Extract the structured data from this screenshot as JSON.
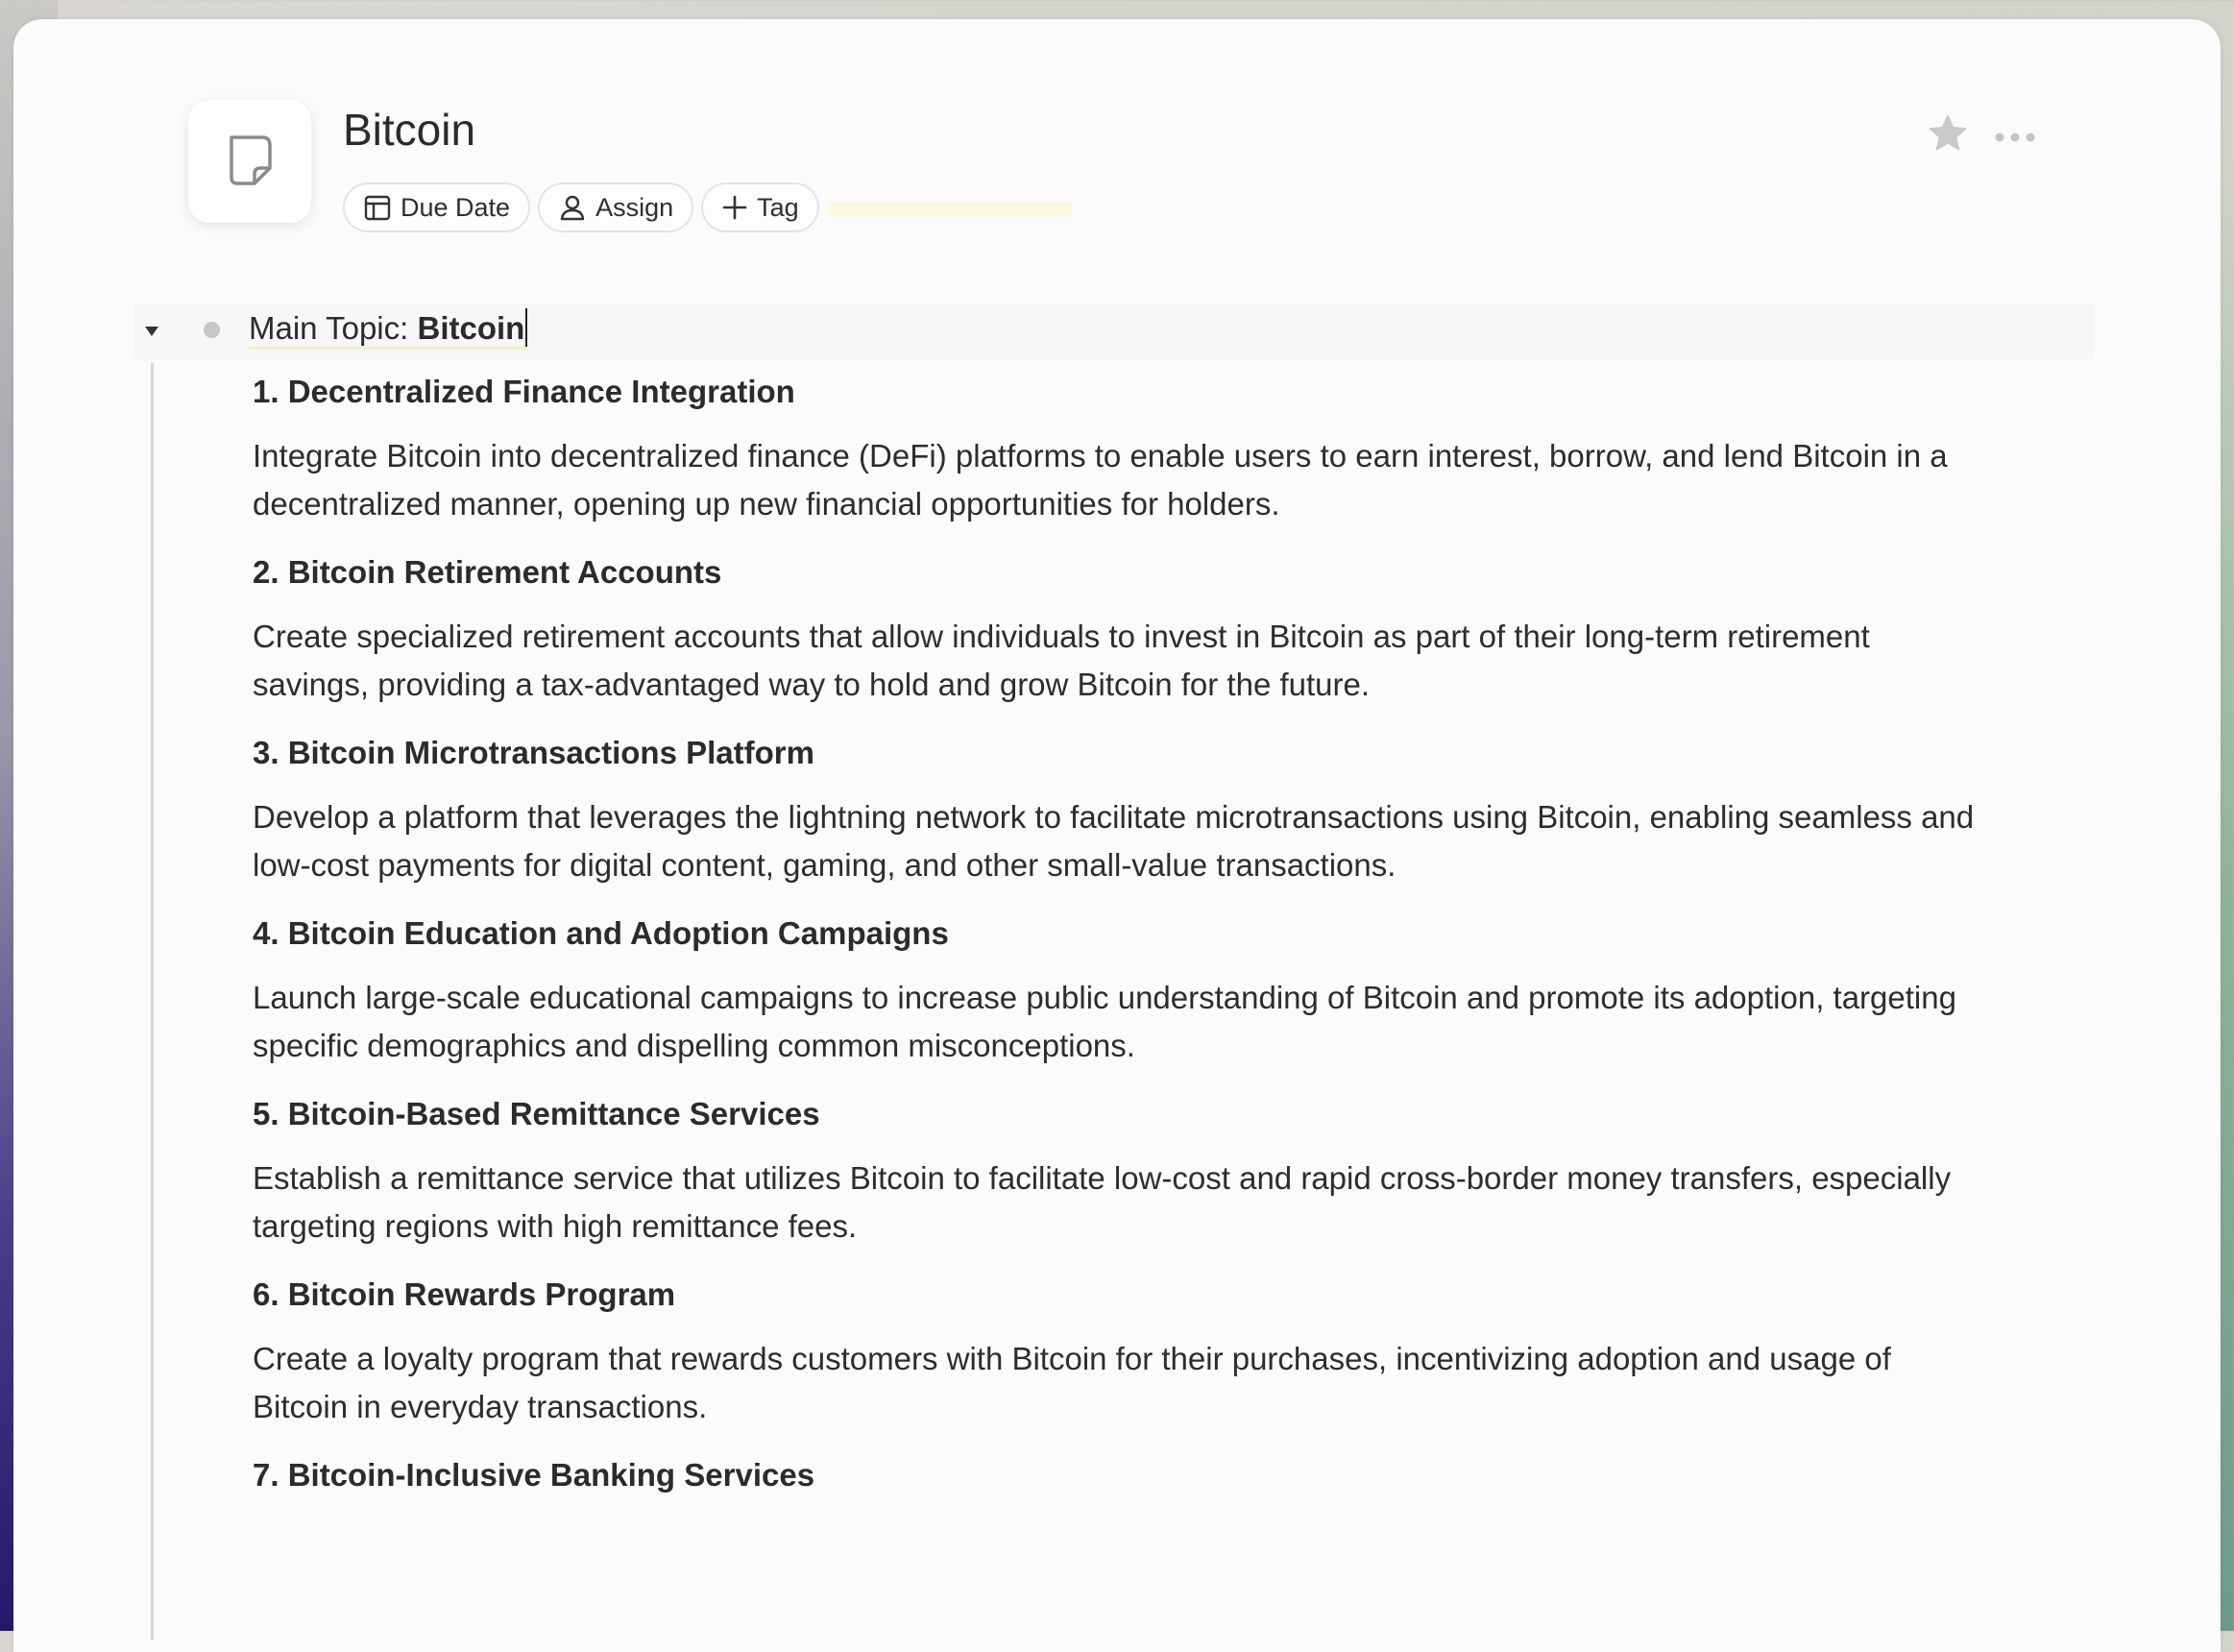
{
  "page": {
    "title": "Bitcoin",
    "properties": {
      "due_date": "Due Date",
      "assign": "Assign",
      "tag": "Tag"
    }
  },
  "outline": {
    "topic_prefix": "Main Topic:",
    "topic_value": "Bitcoin",
    "sections": [
      {
        "heading": "1. Decentralized Finance Integration",
        "body": "Integrate Bitcoin into decentralized finance (DeFi) platforms to enable users to earn interest, borrow, and lend Bitcoin in a decentralized manner, opening up new financial opportunities for holders."
      },
      {
        "heading": "2. Bitcoin Retirement Accounts",
        "body": "Create specialized retirement accounts that allow individuals to invest in Bitcoin as part of their long-term retirement savings, providing a tax-advantaged way to hold and grow Bitcoin for the future."
      },
      {
        "heading": "3. Bitcoin Microtransactions Platform",
        "body": "Develop a platform that leverages the lightning network to facilitate microtransactions using Bitcoin, enabling seamless and low-cost payments for digital content, gaming, and other small-value transactions."
      },
      {
        "heading": "4. Bitcoin Education and Adoption Campaigns",
        "body": "Launch large-scale educational campaigns to increase public understanding of Bitcoin and promote its adoption, targeting specific demographics and dispelling common misconceptions."
      },
      {
        "heading": "5. Bitcoin-Based Remittance Services",
        "body": "Establish a remittance service that utilizes Bitcoin to facilitate low-cost and rapid cross-border money transfers, especially targeting regions with high remittance fees."
      },
      {
        "heading": "6. Bitcoin Rewards Program",
        "body": "Create a loyalty program that rewards customers with Bitcoin for their purchases, incentivizing adoption and usage of Bitcoin in everyday transactions."
      },
      {
        "heading": "7. Bitcoin-Inclusive Banking Services",
        "body": ""
      }
    ]
  },
  "icons": {
    "page": "document-icon",
    "due_date": "calendar-icon",
    "assign": "person-icon",
    "tag": "plus-icon",
    "favorite": "star-icon",
    "more": "more-icon",
    "collapse": "caret-down-icon"
  },
  "colors": {
    "background": "#fbfbfb",
    "text": "#2b2b2b",
    "muted_icon": "#c8c8c8",
    "chip_border": "#e4e4e4",
    "highlight": "#fbf8e2"
  }
}
